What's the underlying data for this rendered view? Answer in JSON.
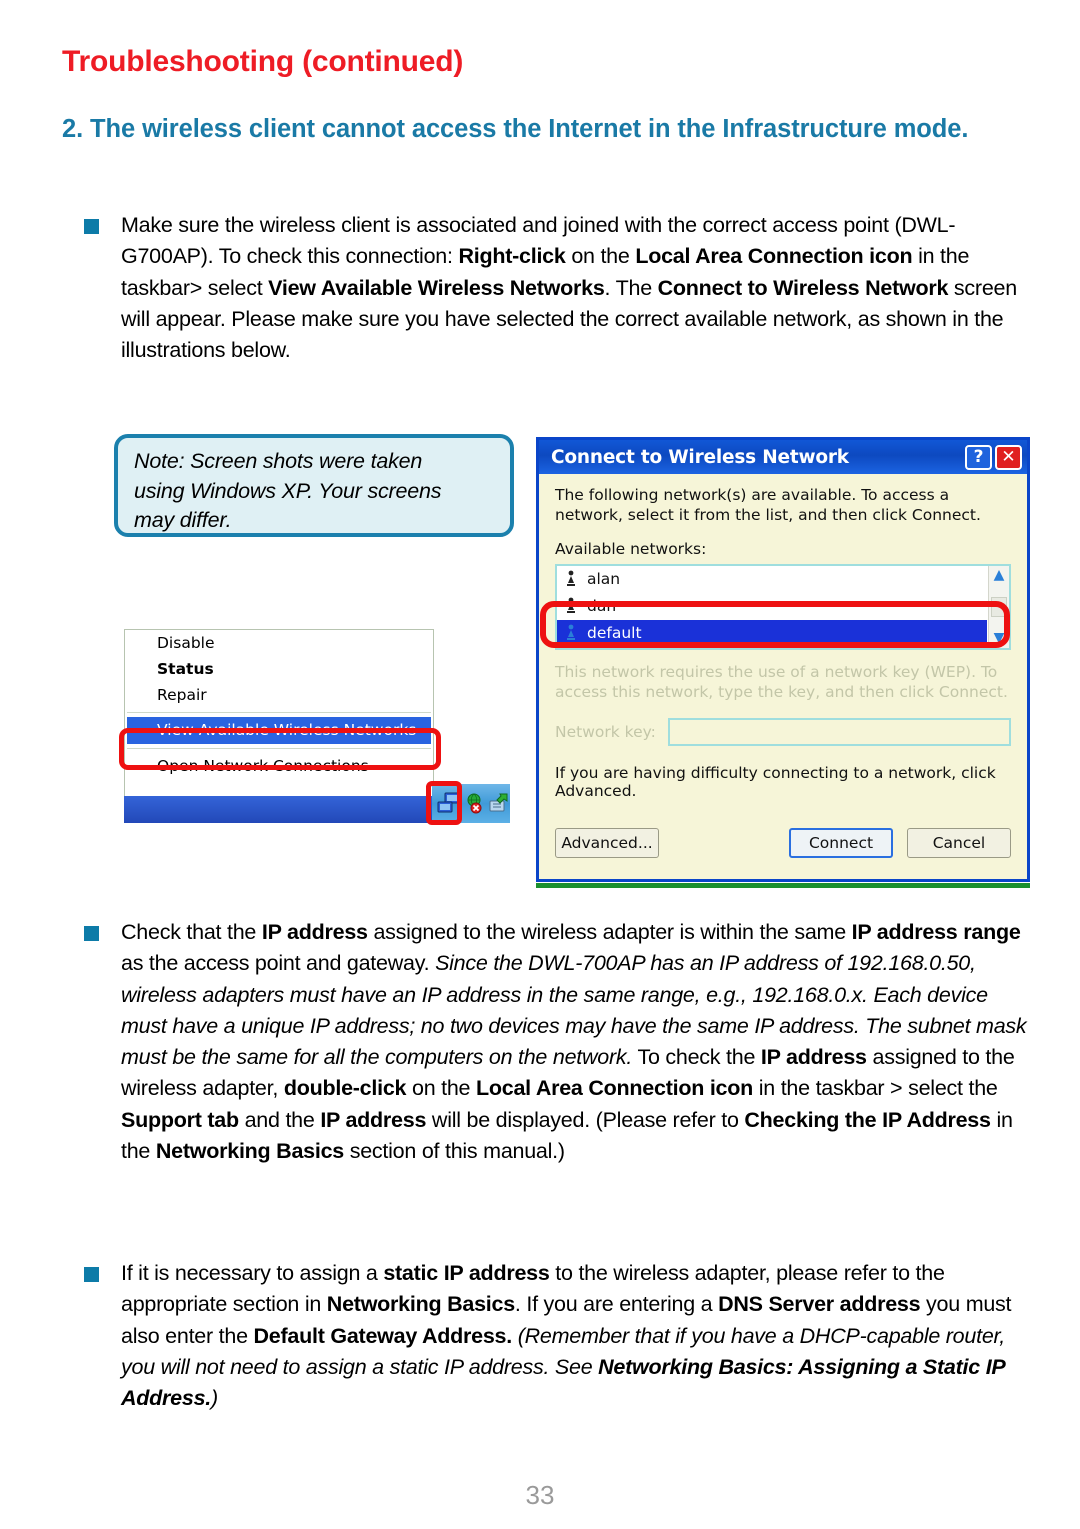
{
  "document": {
    "title": "Troubleshooting (continued)",
    "title_color": "#ee1c25",
    "heading": "2. The wireless client cannot access the Internet in the Infrastructure mode.",
    "heading_color": "#1a7aa6",
    "accent_bullet_color": "#0d7ba8",
    "page_number": "33"
  },
  "note": {
    "line1": "Note: Screen shots were taken",
    "line2": "using Windows XP. Your screens",
    "line3": "may differ.",
    "border_color": "#1b80ad",
    "fill_color": "#dff0f4"
  },
  "bullets": [
    {
      "id": "bullet-1",
      "plain_text": "Make sure the wireless client is associated and joined with the correct access point (DWL-G700AP). To check this connection: Right-click on the Local Area Connection icon in the taskbar> select View Available Wireless Networks. The Connect to Wireless Network screen will appear. Please make sure you have selected the correct available network, as shown in the illustrations below."
    },
    {
      "id": "bullet-2",
      "plain_text": "Check that the IP address assigned to the wireless adapter is within the same IP address range as the access point and gateway. Since the DWL-700AP has an IP address of 192.168.0.50, wireless adapters must have an IP address in the same range, e.g., 192.168.0.x. Each device must have a unique IP address; no two devices may have the same IP address. The subnet mask must be the same for all the computers on the network. To check the IP address assigned to the wireless adapter, double-click on the Local Area Connection icon in the taskbar > select the Support tab and the IP address will be displayed. (Please refer to Checking the IP Address in the Networking Basics section of this manual.)"
    },
    {
      "id": "bullet-3",
      "plain_text": "If it is necessary to assign a static IP address to the wireless adapter, please refer to the appropriate section in Networking Basics. If you are entering a DNS Server address you must also enter the Default Gateway Address. (Remember that if you have a DHCP-capable router, you will not need to assign a static IP address. See Networking Basics: Assigning a Static IP Address.)"
    }
  ],
  "context_menu": {
    "items": [
      {
        "label": "Disable",
        "bold": false,
        "highlighted": false
      },
      {
        "label": "Status",
        "bold": true,
        "highlighted": false
      },
      {
        "label": "Repair",
        "bold": false,
        "highlighted": false
      },
      {
        "label": "View Available Wireless Networks",
        "bold": false,
        "highlighted": true
      },
      {
        "label": "Open Network Connections",
        "bold": false,
        "highlighted": false
      }
    ],
    "highlight_color": "#2a64e0",
    "annotation_color": "#ee1111",
    "tray_icons": [
      "network-connection-icon",
      "globe-error-icon",
      "volume-icon"
    ]
  },
  "dialog": {
    "title": "Connect to Wireless Network",
    "help_button": "?",
    "close_button": "✕",
    "intro_text": "The following network(s) are available. To access a network, select it from the list, and then click Connect.",
    "available_label": "Available networks:",
    "networks": [
      {
        "name": "alan",
        "selected": false
      },
      {
        "name": "dan",
        "selected": false
      },
      {
        "name": "default",
        "selected": true
      },
      {
        "name": "",
        "selected": false
      }
    ],
    "wep_text": "This network requires the use of a network key (WEP). To access this network, type the key, and then click Connect.",
    "key_label": "Network key:",
    "key_value": "",
    "advanced_hint": "If you are having difficulty connecting to a network, click Advanced.",
    "buttons": {
      "advanced": "Advanced...",
      "connect": "Connect",
      "cancel": "Cancel"
    },
    "scroll_up": "▲",
    "scroll_down": "▼"
  }
}
